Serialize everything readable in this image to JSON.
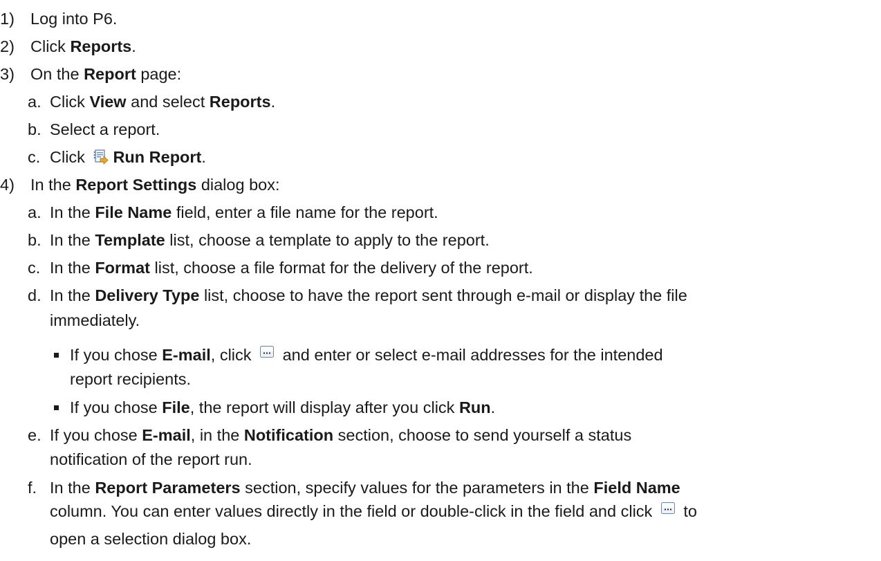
{
  "steps": [
    {
      "num": "1)",
      "parts": [
        {
          "t": "Log into P6."
        }
      ]
    },
    {
      "num": "2)",
      "parts": [
        {
          "t": "Click "
        },
        {
          "t": "Reports",
          "b": true
        },
        {
          "t": "."
        }
      ]
    },
    {
      "num": "3)",
      "parts": [
        {
          "t": "On the "
        },
        {
          "t": "Report",
          "b": true
        },
        {
          "t": " page:"
        }
      ]
    },
    {
      "num": "a.",
      "parts": [
        {
          "t": "Click "
        },
        {
          "t": "View",
          "b": true
        },
        {
          "t": " and select "
        },
        {
          "t": "Reports",
          "b": true
        },
        {
          "t": "."
        }
      ]
    },
    {
      "num": "b.",
      "parts": [
        {
          "t": "Select a report."
        }
      ]
    },
    {
      "num": "c.",
      "parts": [
        {
          "t": "Click "
        },
        {
          "icon": "run-report-icon"
        },
        {
          "t": "Run Report",
          "b": true
        },
        {
          "t": "."
        }
      ]
    },
    {
      "num": "4)",
      "parts": [
        {
          "t": "In the "
        },
        {
          "t": "Report Settings",
          "b": true
        },
        {
          "t": " dialog box:"
        }
      ]
    },
    {
      "num": "a.",
      "parts": [
        {
          "t": "In the "
        },
        {
          "t": "File Name",
          "b": true
        },
        {
          "t": " field, enter a file name for the report."
        }
      ]
    },
    {
      "num": "b.",
      "parts": [
        {
          "t": "In the "
        },
        {
          "t": "Template",
          "b": true
        },
        {
          "t": " list, choose a template to apply to the report."
        }
      ]
    },
    {
      "num": "c.",
      "parts": [
        {
          "t": "In the "
        },
        {
          "t": "Format",
          "b": true
        },
        {
          "t": " list, choose a file format for the delivery of the report."
        }
      ]
    },
    {
      "num": "d.",
      "parts": [
        {
          "t": "In the "
        },
        {
          "t": "Delivery Type",
          "b": true
        },
        {
          "t": " list, choose to have the report sent through e-mail or display the file"
        }
      ]
    },
    {
      "num": "",
      "parts": [
        {
          "t": "immediately."
        }
      ]
    },
    {
      "num": "bullet",
      "parts": [
        {
          "t": "If you chose "
        },
        {
          "t": "E-mail",
          "b": true
        },
        {
          "t": ", click "
        },
        {
          "icon": "ellipsis-button-icon"
        },
        {
          "t": " and enter or select e-mail addresses for the intended"
        }
      ]
    },
    {
      "num": "",
      "parts": [
        {
          "t": "report recipients."
        }
      ]
    },
    {
      "num": "bullet",
      "parts": [
        {
          "t": "If you chose "
        },
        {
          "t": "File",
          "b": true
        },
        {
          "t": ", the report will display after you click "
        },
        {
          "t": "Run",
          "b": true
        },
        {
          "t": "."
        }
      ]
    },
    {
      "num": "e.",
      "parts": [
        {
          "t": "If you chose "
        },
        {
          "t": "E-mail",
          "b": true
        },
        {
          "t": ", in the "
        },
        {
          "t": "Notification",
          "b": true
        },
        {
          "t": " section, choose to send yourself a status"
        }
      ]
    },
    {
      "num": "",
      "parts": [
        {
          "t": "notification of the report run."
        }
      ]
    },
    {
      "num": "f.",
      "parts": [
        {
          "t": "In the "
        },
        {
          "t": "Report Parameters",
          "b": true
        },
        {
          "t": " section, specify values for the parameters in the "
        },
        {
          "t": "Field Name",
          "b": true
        }
      ]
    },
    {
      "num": "",
      "parts": [
        {
          "t": "column. You can enter values directly in the field or double-click in the field and click "
        },
        {
          "icon": "ellipsis-button-icon"
        },
        {
          "t": " to"
        }
      ]
    },
    {
      "num": "",
      "parts": [
        {
          "t": "open a selection dialog box."
        }
      ]
    }
  ]
}
